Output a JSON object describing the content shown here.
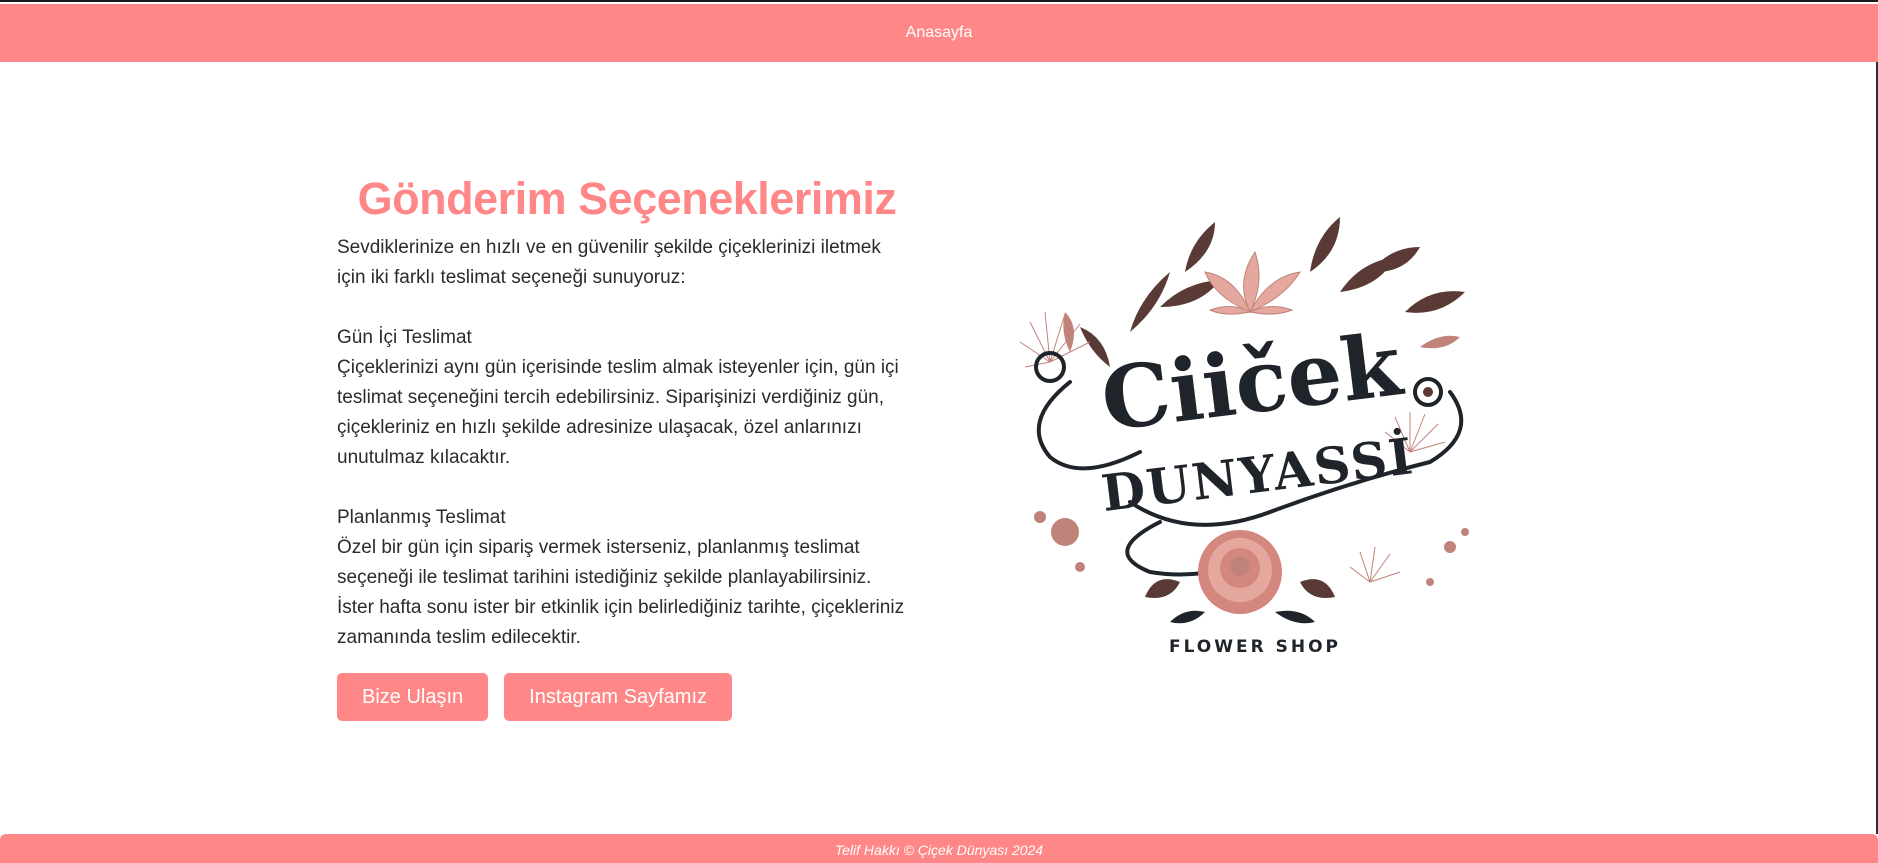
{
  "nav": {
    "home": "Anasayfa"
  },
  "main": {
    "title": "Gönderim Seçeneklerimiz",
    "intro_line1": "Sevdiklerinize en hızlı ve en güvenilir şekilde çiçeklerinizi iletmek",
    "intro_line2": "için iki farklı teslimat seçeneği sunuyoruz:",
    "same_day": {
      "heading": "Gün İçi Teslimat",
      "line1": "Çiçeklerinizi aynı gün içerisinde teslim almak isteyenler için, gün içi",
      "line2": "teslimat seçeneğini tercih edebilirsiniz. Siparişinizi verdiğiniz gün,",
      "line3": "çiçekleriniz en hızlı şekilde adresinize ulaşacak, özel anlarınızı",
      "line4": "unutulmaz kılacaktır."
    },
    "planned": {
      "heading": "Planlanmış Teslimat",
      "line1": "Özel bir gün için sipariş vermek isterseniz, planlanmış teslimat",
      "line2": "seçeneği ile teslimat tarihini istediğiniz şekilde planlayabilirsiniz.",
      "line3": "İster hafta sonu ister bir etkinlik için belirlediğiniz tarihte, çiçekleriniz",
      "line4": "zamanında teslim edilecektir."
    },
    "buttons": {
      "contact": "Bize Ulaşın",
      "instagram": "Instagram Sayfamız"
    }
  },
  "logo": {
    "line1": "Ciiček",
    "line2": "DUNYASSİ",
    "subtitle": "FLOWER SHOP"
  },
  "footer": {
    "text": "Telif Hakkı © Çiçek Dünyası 2024"
  },
  "colors": {
    "accent": "#ff8787",
    "text": "#2b2b2b",
    "logo_dark": "#1e2429",
    "petal": "#d4877f",
    "leaf": "#5a3a35"
  }
}
